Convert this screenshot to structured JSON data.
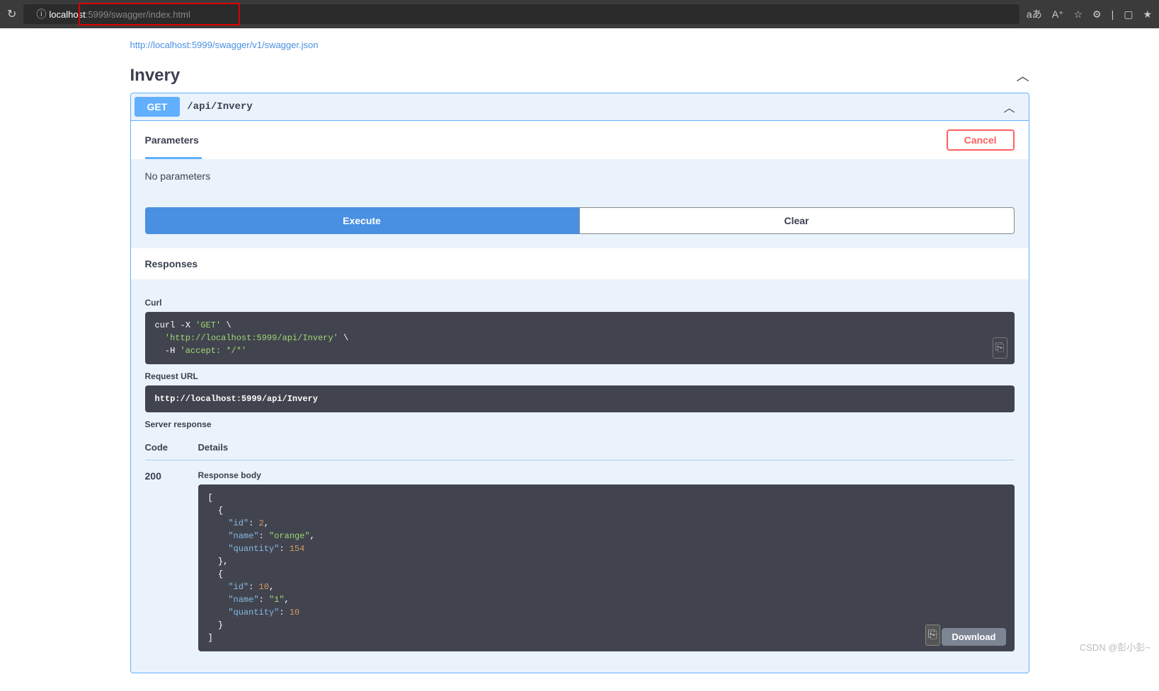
{
  "browser": {
    "url_host": "localhost",
    "url_port_path": ":5999/swagger/index.html"
  },
  "top_link": "http://localhost:5999/swagger/v1/swagger.json",
  "tag": {
    "name": "Invery"
  },
  "op": {
    "method": "GET",
    "path": "/api/Invery"
  },
  "sections": {
    "parameters_title": "Parameters",
    "cancel": "Cancel",
    "no_params": "No parameters",
    "execute": "Execute",
    "clear": "Clear",
    "responses_title": "Responses",
    "curl_label": "Curl",
    "request_url_label": "Request URL",
    "server_response_label": "Server response",
    "code_col": "Code",
    "details_col": "Details",
    "response_body_label": "Response body",
    "download": "Download"
  },
  "curl": {
    "l1a": "curl -X ",
    "l1b": "'GET'",
    "l1c": " \\",
    "l2a": "  ",
    "l2b": "'http://localhost:5999/api/Invery'",
    "l2c": " \\",
    "l3a": "  -H ",
    "l3b": "'accept: */*'"
  },
  "request_url": "http://localhost:5999/api/Invery",
  "response": {
    "code": "200",
    "body_items": [
      {
        "id": 2,
        "name": "orange",
        "quantity": 154
      },
      {
        "id": 10,
        "name": "1",
        "quantity": 10
      }
    ]
  },
  "watermark": "CSDN @彭小彭~"
}
